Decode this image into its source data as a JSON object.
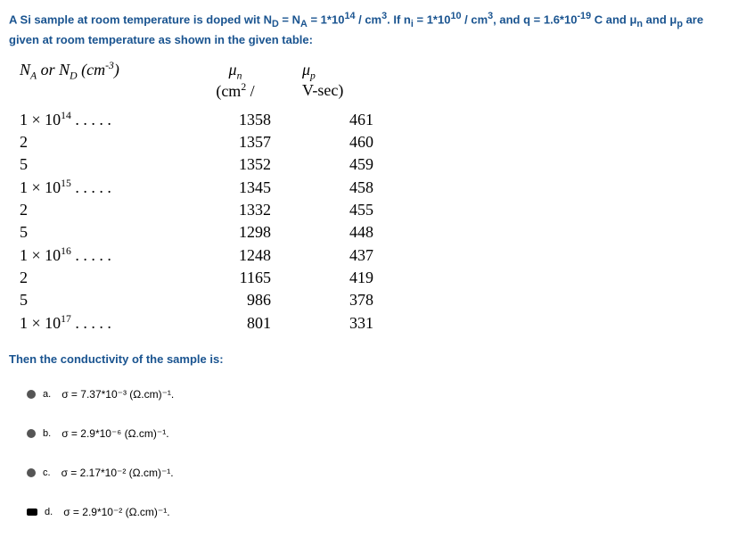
{
  "question": {
    "intro": "A Si sample at room temperature is doped wit N<sub>D</sub> = N<sub>A</sub> = 1*10<sup>14</sup> / cm<sup>3</sup>. If n<sub>i</sub> = 1*10<sup>10</sup> / cm<sup>3</sup>, and q = 1.6*10<sup>-19</sup> C and μ<sub>n</sub> and μ<sub>p</sub> are given at room temperature as shown in the given table:",
    "intro_text": "A Si sample at room temperature is doped wit N",
    "conclusion": "Then the conductivity of the sample is:"
  },
  "table": {
    "header_conc": "N_A or N_D (cm⁻³)",
    "header_mun_sym": "μ",
    "header_mun_sub": "n",
    "header_mup_sym": "μ",
    "header_mup_sub": "p",
    "header_unit": "(cm² / V-sec)",
    "rows": [
      {
        "conc": "1 × 10¹⁴ . . . . .",
        "mun": "1358",
        "mup": "461"
      },
      {
        "conc": "2",
        "mun": "1357",
        "mup": "460"
      },
      {
        "conc": "5",
        "mun": "1352",
        "mup": "459"
      },
      {
        "conc": "1 × 10¹⁵ . . . . .",
        "mun": "1345",
        "mup": "458"
      },
      {
        "conc": "2",
        "mun": "1332",
        "mup": "455"
      },
      {
        "conc": "5",
        "mun": "1298",
        "mup": "448"
      },
      {
        "conc": "1 × 10¹⁶ . . . . .",
        "mun": "1248",
        "mup": "437"
      },
      {
        "conc": "2",
        "mun": "1165",
        "mup": "419"
      },
      {
        "conc": "5",
        "mun": "986",
        "mup": "378"
      },
      {
        "conc": "1 × 10¹⁷ . . . . .",
        "mun": "801",
        "mup": "331"
      }
    ]
  },
  "options": {
    "a": {
      "label": "a.",
      "text": "σ = 7.37*10⁻³ (Ω.cm)⁻¹."
    },
    "b": {
      "label": "b.",
      "text": "σ = 2.9*10⁻⁶ (Ω.cm)⁻¹."
    },
    "c": {
      "label": "c.",
      "text": "σ = 2.17*10⁻² (Ω.cm)⁻¹."
    },
    "d": {
      "label": "d.",
      "text": "σ = 2.9*10⁻² (Ω.cm)⁻¹."
    }
  },
  "chart_data": {
    "type": "table",
    "title": "Mobility vs Doping Concentration",
    "columns": [
      "N_A or N_D (cm⁻³)",
      "μn (cm²/V-sec)",
      "μp (cm²/V-sec)"
    ],
    "data": [
      [
        "1×10¹⁴",
        1358,
        461
      ],
      [
        "2×10¹⁴",
        1357,
        460
      ],
      [
        "5×10¹⁴",
        1352,
        459
      ],
      [
        "1×10¹⁵",
        1345,
        458
      ],
      [
        "2×10¹⁵",
        1332,
        455
      ],
      [
        "5×10¹⁵",
        1298,
        448
      ],
      [
        "1×10¹⁶",
        1248,
        437
      ],
      [
        "2×10¹⁶",
        1165,
        419
      ],
      [
        "5×10¹⁶",
        986,
        378
      ],
      [
        "1×10¹⁷",
        801,
        331
      ]
    ]
  }
}
